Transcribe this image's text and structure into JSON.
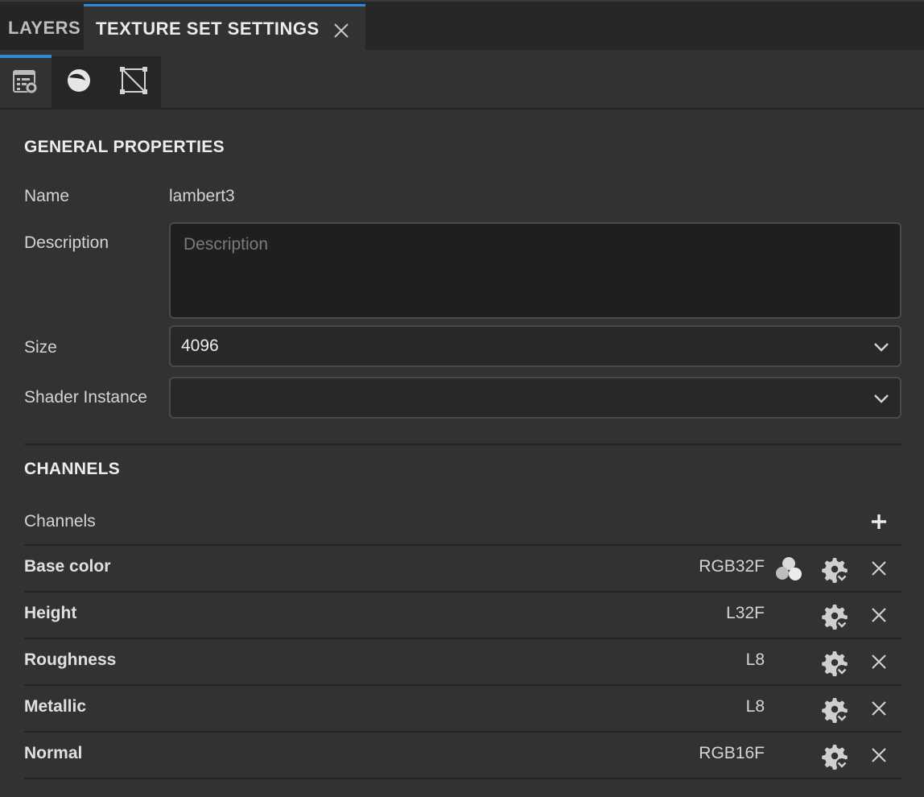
{
  "tabs": {
    "layers_label": "LAYERS",
    "texture_set_label": "TEXTURE SET SETTINGS"
  },
  "toolbar": {
    "items": [
      "texture-set-settings-icon",
      "material-sphere-icon",
      "uv-square-icon"
    ]
  },
  "general": {
    "section_title": "GENERAL PROPERTIES",
    "name_label": "Name",
    "name_value": "lambert3",
    "description_label": "Description",
    "description_placeholder": "Description",
    "size_label": "Size",
    "size_value": "4096",
    "shader_label": "Shader Instance",
    "shader_value": ""
  },
  "channels": {
    "section_title": "CHANNELS",
    "list_label": "Channels",
    "items": [
      {
        "name": "Base color",
        "format": "RGB32F"
      },
      {
        "name": "Height",
        "format": "L32F"
      },
      {
        "name": "Roughness",
        "format": "L8"
      },
      {
        "name": "Metallic",
        "format": "L8"
      },
      {
        "name": "Normal",
        "format": "RGB16F"
      }
    ]
  },
  "colors": {
    "accent": "#2d8ad8",
    "panel_bg": "#323232",
    "field_bg": "#1f1f1f"
  }
}
